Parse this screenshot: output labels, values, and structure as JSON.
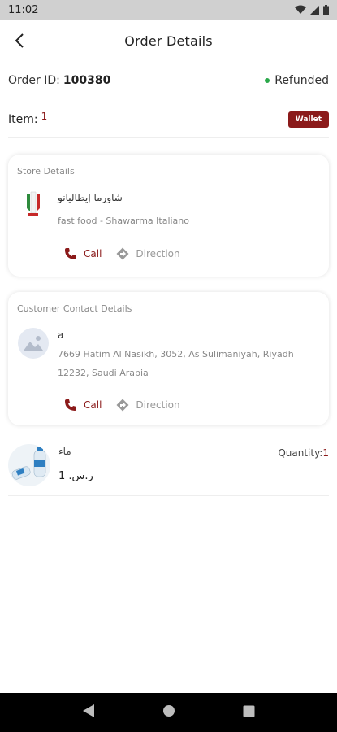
{
  "status_bar": {
    "time": "11:02"
  },
  "header": {
    "title": "Order Details"
  },
  "order": {
    "id_label": "Order ID:",
    "id_value": "100380",
    "status": "Refunded",
    "status_color": "#2aa84a",
    "item_label": "Item:",
    "item_count": "1",
    "payment_badge": "Wallet",
    "accent_color": "#8b1a1a"
  },
  "store": {
    "section_title": "Store Details",
    "name": "شاورما إيطاليانو",
    "subtitle": "fast food - Shawarma Italiano",
    "call_label": "Call",
    "direction_label": "Direction"
  },
  "customer": {
    "section_title": "Customer Contact Details",
    "name": "a",
    "address": "7669 Hatim Al Nasikh, 3052, As Sulimaniyah, Riyadh 12232, Saudi Arabia",
    "call_label": "Call",
    "direction_label": "Direction"
  },
  "product": {
    "name": "ماء",
    "price": "ر.س. 1",
    "quantity_label": "Quantity:",
    "quantity_value": "1"
  },
  "icons": {
    "back": "arrow-left-icon",
    "phone": "phone-icon",
    "direction": "direction-icon",
    "placeholder": "image-placeholder-icon",
    "nav_back": "triangle-back-icon",
    "nav_home": "circle-home-icon",
    "nav_recent": "square-recent-icon"
  }
}
